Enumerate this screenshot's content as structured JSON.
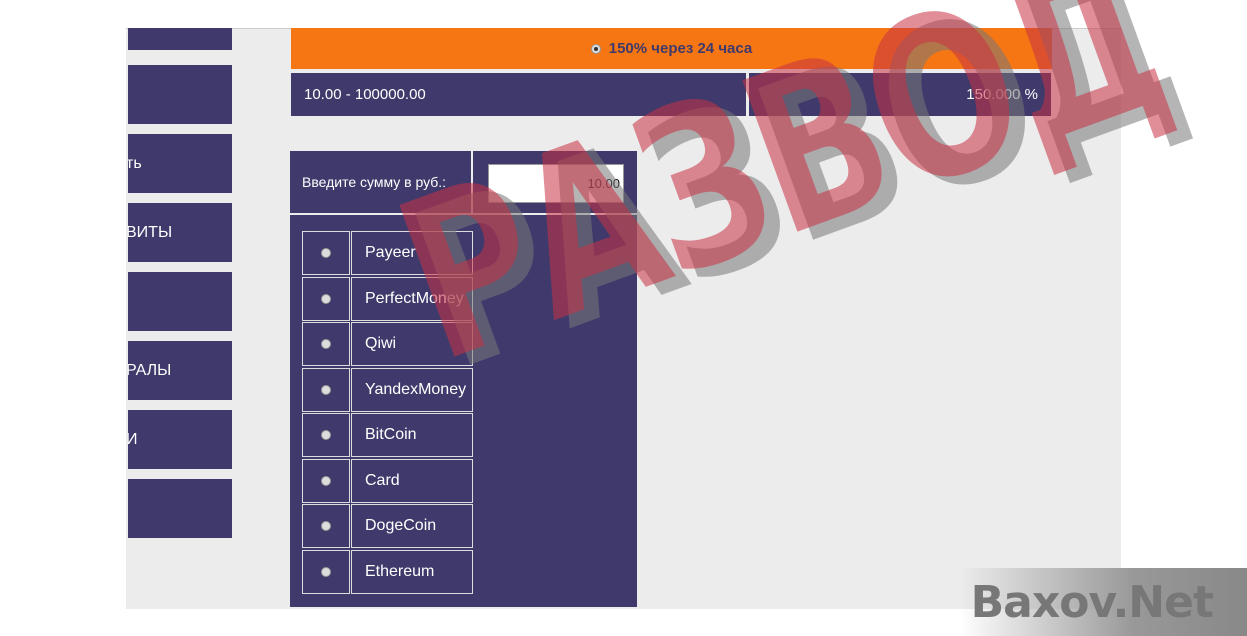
{
  "sidebar": {
    "items": [
      {
        "label": ""
      },
      {
        "label": ""
      },
      {
        "label": "ть"
      },
      {
        "label": "ВИТЫ"
      },
      {
        "label": ""
      },
      {
        "label": "РАЛЫ"
      },
      {
        "label": "И"
      },
      {
        "label": ""
      }
    ]
  },
  "plan": {
    "title": "150% через 24 часа",
    "range": "10.00 - 100000.00",
    "percent": "150.000 %"
  },
  "calc": {
    "amount_label": "Введите сумму в руб.:",
    "amount_value": "10.00",
    "methods": [
      "Payeer",
      "PerfectMoney",
      "Qiwi",
      "YandexMoney",
      "BitCoin",
      "Card",
      "DogeCoin",
      "Ethereum"
    ]
  },
  "watermark": "РАЗВОД",
  "logo": "Baxov.Net",
  "colors": {
    "accent": "#f57613",
    "panel": "#3f3a6b",
    "watermark": "#c83246"
  }
}
